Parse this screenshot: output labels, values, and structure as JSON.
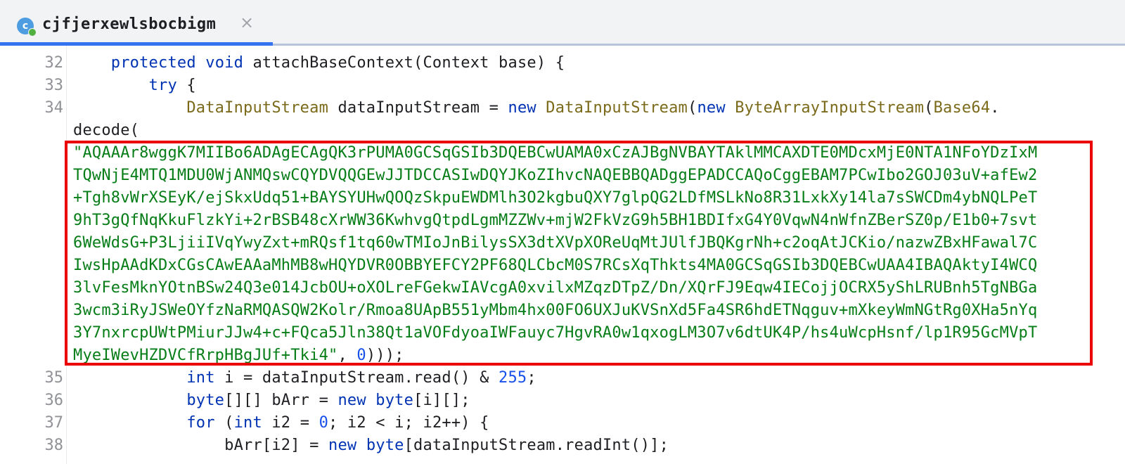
{
  "tab": {
    "icon": "java-class-icon",
    "icon_letter": "c",
    "title": "cjfjerxewlsbocbigm",
    "close_icon": "close-icon",
    "close_glyph": "×"
  },
  "editor": {
    "line_numbers": [
      "32",
      "33",
      "34",
      "35",
      "36",
      "37",
      "38"
    ],
    "lines": {
      "l32": {
        "kw1": "protected",
        "kw2": "void",
        "text": " attachBaseContext(Context base) {"
      },
      "l33": {
        "kw": "try",
        "text": " {"
      },
      "l34": {
        "type1": "DataInputStream",
        "text1": " dataInputStream = ",
        "kw1": "new",
        "type2": "DataInputStream",
        "text2": "(",
        "kw2": "new",
        "type3": "ByteArrayInputStream",
        "text3": "(",
        "type4": "Base64",
        "text4": "."
      },
      "decode": "decode(",
      "base64_lines": [
        "\"AQAAAr8wggK7MIIBo6ADAgECAgQK3rPUMA0GCSqGSIb3DQEBCwUAMA0xCzAJBgNVBAYTAklMMCAXDTE0MDcxMjE0NTA1NFoYDzIxM",
        "TQwNjE4MTQ1MDU0WjANMQswCQYDVQQGEwJJTDCCASIwDQYJKoZIhvcNAQEBBQADggEPADCCAQoCggEBAM7PCwIbo2GOJ03uV+afEw2",
        "+Tgh8vWrXSEyK/ejSkxUdq51+BAYSYUHwQOQzSkpuEWDMlh3O2kgbuQXY7glpQG2LDfMSLkNo8R31LxkXy14la7sSWCDm4ybNQLPeT",
        "9hT3gQfNqKkuFlzkYi+2rBSB48cXrWW36KwhvgQtpdLgmMZZWv+mjW2FkVzG9h5BH1BDIfxG4Y0VqwN4nWfnZBerSZ0p/E1b0+7svt",
        "6WeWdsG+P3LjiiIVqYwyZxt+mRQsf1tq60wTMIoJnBilysSX3dtXVpXOReUqMtJUlfJBQKgrNh+c2oqAtJCKio/nazwZBxHFawal7C",
        "IwsHpAAdKDxCGsCAwEAAaMhMB8wHQYDVR0OBBYEFCY2PF68QLCbcM0S7RCsXqThkts4MA0GCSqGSIb3DQEBCwUAA4IBAQAktyI4WCQ",
        "3lvFesMknYOtnBSw24Q3e014JcbOU+oXOLreFGekwIAVcgA0xvilxMZqzDTpZ/Dn/XQrFJ9Eqw4IECojjOCRX5yShLRUBnh5TgNBGa",
        "3wcm3iRyJSWeOYfzNaRMQASQW2Kolr/Rmoa8UApB551yMbm4hx00FO6UXJuKVSnXd5Fa4SR6hdETNqguv+mXkeyWmNGtRg0XHa5nYq",
        "3Y7nxrcpUWtPMiurJJw4+c+FQca5Jln38Qt1aVOFdyoaIWFauyc7HgvRA0w1qxogLM3O7v6dtUK4P/hs4uWcpHsnf/lp1R95GcMVpT",
        "MyeIWevHZDVCfRrpHBgJUf+Tki4\""
      ],
      "base64_tail_sep": ", ",
      "base64_tail_num": "0",
      "base64_tail_close": ")));",
      "l35": {
        "kw": "int",
        "text1": " i = dataInputStream.read() & ",
        "num": "255",
        "text2": ";"
      },
      "l36": {
        "kw1": "byte",
        "text1": "[][] bArr = ",
        "kw2": "new",
        "kw3": "byte",
        "text2": "[i][];"
      },
      "l37": {
        "kw1": "for",
        "text1": " (",
        "kw2": "int",
        "text2": " i2 = ",
        "num": "0",
        "text3": "; i2 < i; i2++) {"
      },
      "l38": {
        "text1": "bArr[i2] = ",
        "kw1": "new",
        "kw2": "byte",
        "text2": "[dataInputStream.readInt()];"
      }
    }
  },
  "colors": {
    "keyword": "#0033b3",
    "type": "#7a6a1a",
    "string": "#067d17",
    "number": "#1750eb",
    "highlight_border": "#ea0000",
    "tab_underline": "#3574f0"
  }
}
